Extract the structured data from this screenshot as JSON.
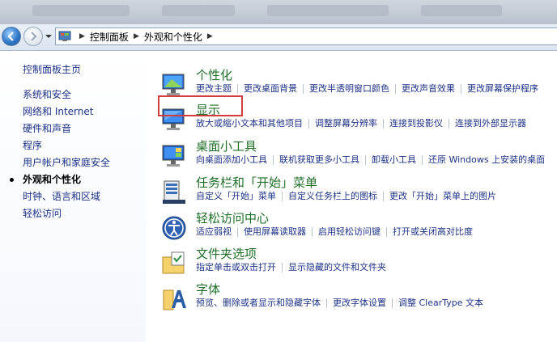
{
  "address": {
    "segments": [
      "控制面板",
      "外观和个性化"
    ]
  },
  "sidebar": {
    "home": "控制面板主页",
    "items": [
      {
        "label": "系统和安全",
        "active": false
      },
      {
        "label": "网络和 Internet",
        "active": false
      },
      {
        "label": "硬件和声音",
        "active": false
      },
      {
        "label": "程序",
        "active": false
      },
      {
        "label": "用户帐户和家庭安全",
        "active": false
      },
      {
        "label": "外观和个性化",
        "active": true
      },
      {
        "label": "时钟、语言和区域",
        "active": false
      },
      {
        "label": "轻松访问",
        "active": false
      }
    ]
  },
  "categories": [
    {
      "title": "个性化",
      "icon": "personalization-icon",
      "links": [
        "更改主题",
        "更改桌面背景",
        "更改半透明窗口颜色",
        "更改声音效果",
        "更改屏幕保护程序"
      ]
    },
    {
      "title": "显示",
      "icon": "display-icon",
      "links": [
        "放大或缩小文本和其他项目",
        "调整屏幕分辨率",
        "连接到投影仪",
        "连接到外部显示器"
      ]
    },
    {
      "title": "桌面小工具",
      "icon": "gadgets-icon",
      "links": [
        "向桌面添加小工具",
        "联机获取更多小工具",
        "卸载小工具",
        "还原 Windows 上安装的桌面"
      ]
    },
    {
      "title": "任务栏和「开始」菜单",
      "icon": "taskbar-icon",
      "links": [
        "自定义「开始」菜单",
        "自定义任务栏上的图标",
        "更改「开始」菜单上的图片"
      ]
    },
    {
      "title": "轻松访问中心",
      "icon": "ease-of-access-icon",
      "links": [
        "适应弱视",
        "使用屏幕读取器",
        "启用轻松访问键",
        "打开或关闭高对比度"
      ]
    },
    {
      "title": "文件夹选项",
      "icon": "folder-options-icon",
      "links": [
        "指定单击或双击打开",
        "显示隐藏的文件和文件夹"
      ]
    },
    {
      "title": "字体",
      "icon": "fonts-icon",
      "links": [
        "预览、删除或者显示和隐藏字体",
        "更改字体设置",
        "调整 ClearType 文本"
      ]
    }
  ],
  "colors": {
    "link": "#1e3287",
    "title": "#1f6f28",
    "highlight": "#d43d3d"
  }
}
